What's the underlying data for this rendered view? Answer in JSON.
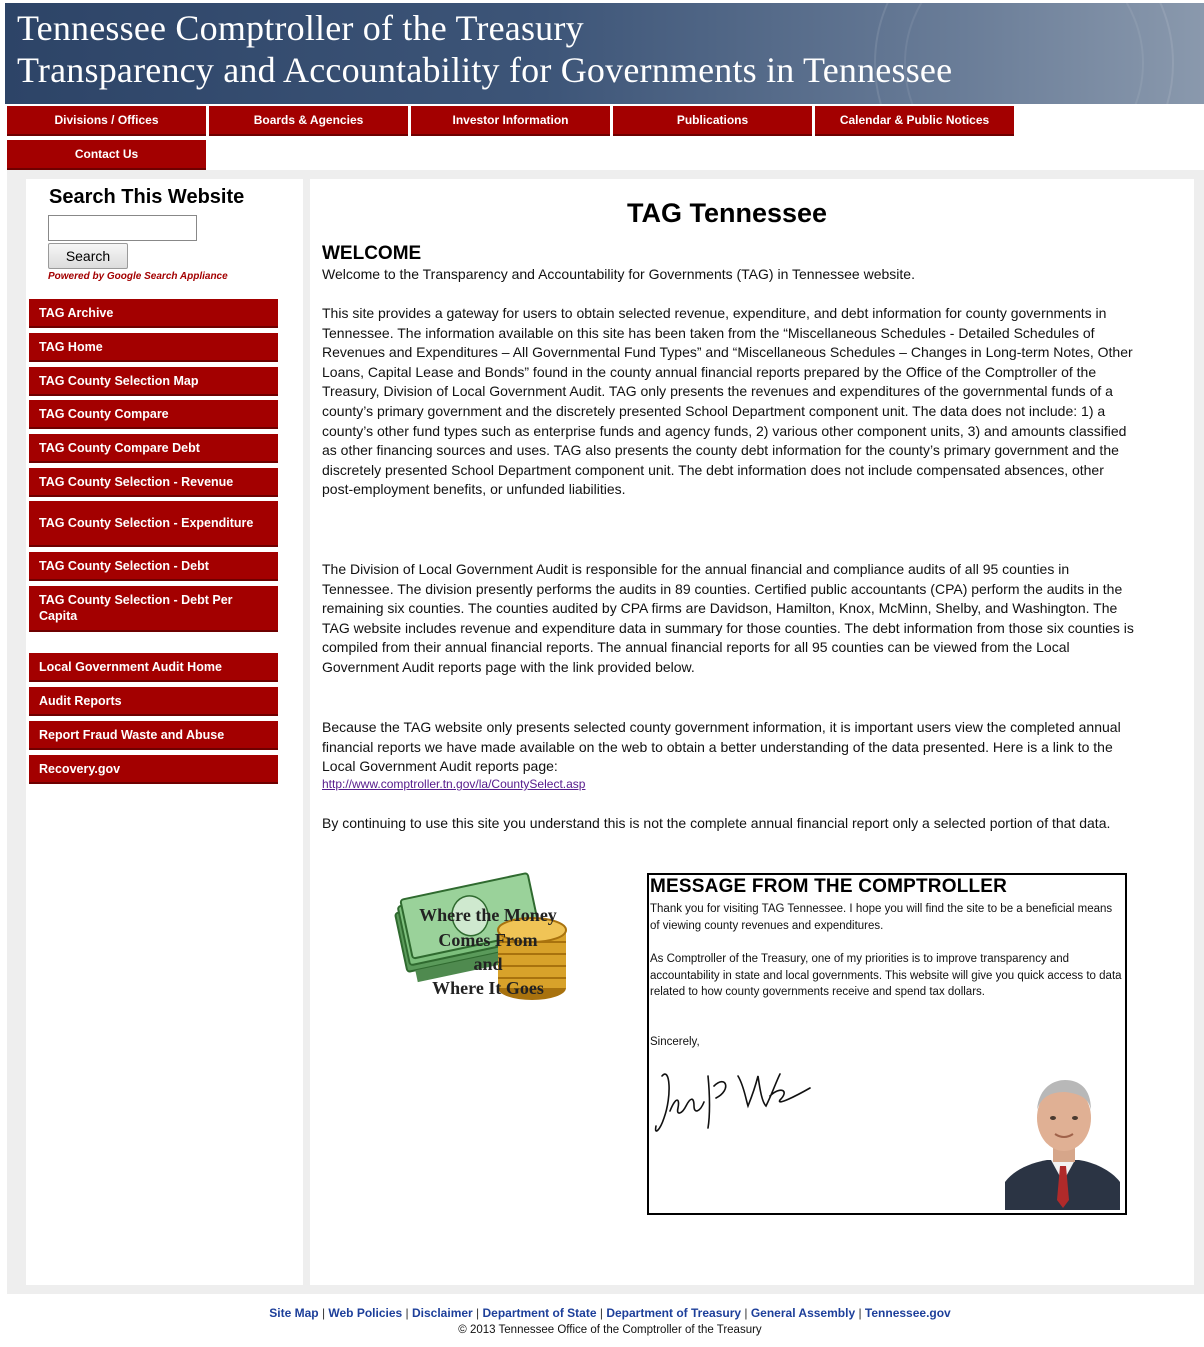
{
  "header": {
    "title_line1": "Tennessee Comptroller of the Treasury",
    "title_line2": "Transparency and Accountability for Governments in Tennessee"
  },
  "nav": {
    "items": [
      {
        "label": "Divisions / Offices"
      },
      {
        "label": "Boards & Agencies"
      },
      {
        "label": "Investor Information"
      },
      {
        "label": "Publications"
      },
      {
        "label": "Calendar & Public Notices"
      },
      {
        "label": "Contact Us"
      }
    ]
  },
  "search": {
    "title": "Search This Website",
    "input_value": "",
    "button_label": "Search",
    "powered_by": "Powered by Google Search Appliance"
  },
  "sidebar": {
    "items": [
      {
        "label": "TAG Archive"
      },
      {
        "label": "TAG Home"
      },
      {
        "label": "TAG County Selection Map"
      },
      {
        "label": "TAG County Compare"
      },
      {
        "label": "TAG County Compare Debt"
      },
      {
        "label": "TAG County Selection - Revenue"
      },
      {
        "label": "TAG County Selection - Expenditure"
      },
      {
        "label": "TAG County Selection - Debt"
      },
      {
        "label": "TAG County Selection - Debt Per Capita"
      },
      {
        "label": "Local Government Audit Home"
      },
      {
        "label": "Audit Reports"
      },
      {
        "label": "Report Fraud Waste and Abuse"
      },
      {
        "label": "Recovery.gov"
      }
    ]
  },
  "main": {
    "title": "TAG Tennessee",
    "welcome_heading": "WELCOME",
    "welcome_text": "Welcome to the Transparency and Accountability for Governments (TAG) in Tennessee website.",
    "para1": "This site provides a gateway for users to obtain selected revenue, expenditure, and debt information for county governments in Tennessee. The information available on this site has been taken from the “Miscellaneous Schedules - Detailed Schedules of Revenues and Expenditures – All Governmental Fund Types” and “Miscellaneous Schedules – Changes in Long-term Notes, Other Loans, Capital Lease and Bonds” found in the county annual financial reports prepared by the Office of the Comptroller of the Treasury, Division of Local Government Audit. TAG only presents the revenues and expenditures of the governmental funds of a county’s primary government and the discretely presented School Department component unit. The data does not include: 1) a county’s other fund types such as enterprise funds and agency funds, 2) various other component units, 3) and amounts classified as other financing sources and uses. TAG also presents the county debt information for the county’s primary government and the discretely presented School Department component unit. The debt information does not include compensated absences, other post-employment benefits, or unfunded liabilities.",
    "para2": "The Division of Local Government Audit is responsible for the annual financial and compliance audits of all 95 counties in Tennessee. The division presently performs the audits in 89 counties. Certified public accountants (CPA) perform the audits in the remaining six counties. The counties audited by CPA firms are Davidson, Hamilton, Knox, McMinn, Shelby, and Washington. The TAG website includes revenue and expenditure data in summary for those counties. The debt information from those six counties is compiled from their annual financial reports. The annual financial reports for all 95 counties can be viewed from the Local Government Audit reports page with the link provided below.",
    "para3": "Because the TAG website only presents selected county government information, it is important users view the completed annual financial reports we have made available on the web to obtain a better understanding of the data presented. Here is a link to the Local Government Audit reports page:",
    "link": "http://www.comptroller.tn.gov/la/CountySelect.asp",
    "para4": "By continuing to use this site you understand this is not the complete annual financial report only a selected portion of that data.",
    "graphic_text": [
      "Where the Money",
      "Comes From",
      "and",
      "Where It Goes"
    ]
  },
  "message": {
    "heading": "MESSAGE FROM THE COMPTROLLER",
    "p1": "Thank you for visiting TAG Tennessee. I hope you will find the site to be a beneficial means of viewing county revenues and expenditures.",
    "p2": "As Comptroller of the Treasury, one of my priorities is to improve transparency and accountability in state and local governments. This website will give you quick access to data related to how county governments receive and spend tax dollars.",
    "p3": "Sincerely,"
  },
  "footer": {
    "links": [
      "Site Map",
      "Web Policies",
      "Disclaimer",
      "Department of State",
      "Department of Treasury",
      "General Assembly",
      "Tennessee.gov"
    ],
    "copyright": "© 2013 Tennessee Office of the Comptroller of the Treasury"
  },
  "colors": {
    "nav_red": "#a30000",
    "banner_blue": "#2d4467",
    "link_purple": "#551a8b",
    "footer_blue": "#1d3f9a"
  }
}
